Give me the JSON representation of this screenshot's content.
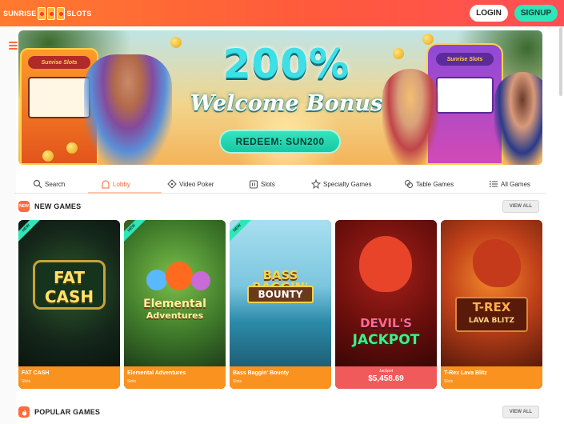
{
  "header": {
    "logo_left": "SUNRISE",
    "logo_right": "SLOTS",
    "login_label": "LOGIN",
    "signup_label": "SIGNUP"
  },
  "banner": {
    "headline": "200%",
    "subheadline": "Welcome Bonus",
    "redeem_label": "REDEEM: SUN200",
    "machine_label": "Sunrise Slots"
  },
  "categories": [
    {
      "label": "Search",
      "icon": "search-icon"
    },
    {
      "label": "Lobby",
      "icon": "lobby-icon",
      "active": true
    },
    {
      "label": "Video Poker",
      "icon": "video-poker-icon"
    },
    {
      "label": "Slots",
      "icon": "slots-icon"
    },
    {
      "label": "Specialty Games",
      "icon": "specialty-icon"
    },
    {
      "label": "Table Games",
      "icon": "table-games-icon"
    },
    {
      "label": "All Games",
      "icon": "all-games-icon"
    }
  ],
  "sections": {
    "new_games": {
      "title": "NEW GAMES",
      "view_all": "VIEW ALL",
      "icon_text": "NEW"
    },
    "popular_games": {
      "title": "POPULAR GAMES",
      "view_all": "VIEW ALL"
    }
  },
  "games": [
    {
      "name": "FAT CASH",
      "provider": "Slots",
      "art_line1": "FAT",
      "art_line2": "CASH",
      "ribbon": "NEW"
    },
    {
      "name": "Elemental Adventures",
      "provider": "Slots",
      "art_line1": "Elemental",
      "art_line2": "Adventures",
      "ribbon": "NEW"
    },
    {
      "name": "Bass Baggin' Bounty",
      "provider": "Slots",
      "art_line1": "BASS BAGGIN'",
      "art_line2": "BOUNTY",
      "ribbon": "NEW"
    },
    {
      "name": "Devil's Jackpot",
      "jackpot_label": "Jackpot",
      "jackpot_amount": "$5,458.69",
      "art_line1": "DEVIL'S",
      "art_line2": "JACKPOT"
    },
    {
      "name": "T-Rex Lava Blitz",
      "provider": "Slots",
      "art_line1": "T-REX",
      "art_line2": "LAVA BLITZ"
    }
  ],
  "colors": {
    "brand_orange": "#ff6a3c",
    "accent_teal": "#2ee6b8",
    "card_footer": "#f9921f",
    "jackpot_footer": "#f15a5a"
  }
}
